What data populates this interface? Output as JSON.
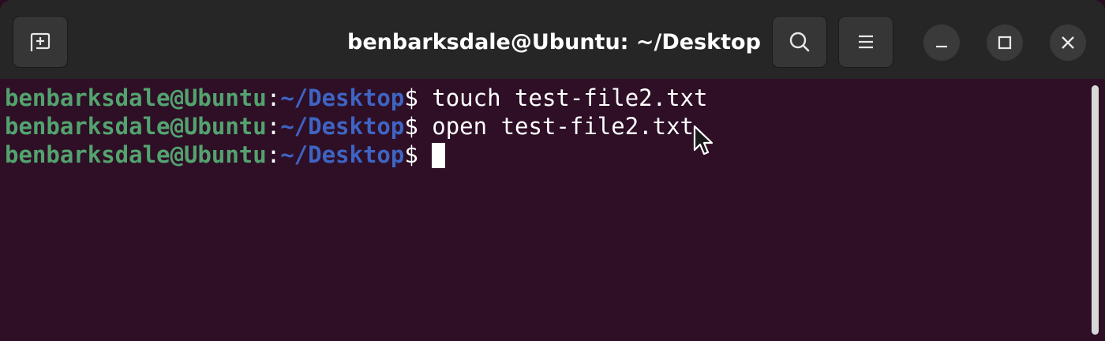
{
  "window": {
    "title": "benbarksdale@Ubuntu: ~/Desktop"
  },
  "titlebar": {
    "new_tab_icon": "new-tab-icon",
    "search_icon": "search-icon",
    "menu_icon": "hamburger-menu-icon",
    "minimize_icon": "minimize-icon",
    "maximize_icon": "maximize-icon",
    "close_icon": "close-icon"
  },
  "terminal": {
    "lines": [
      {
        "user": "benbarksdale@Ubuntu",
        "sep": ":",
        "path": "~/Desktop",
        "prompt": "$ ",
        "command": "touch test-file2.txt"
      },
      {
        "user": "benbarksdale@Ubuntu",
        "sep": ":",
        "path": "~/Desktop",
        "prompt": "$ ",
        "command": "open test-file2.txt"
      },
      {
        "user": "benbarksdale@Ubuntu",
        "sep": ":",
        "path": "~/Desktop",
        "prompt": "$ ",
        "command": ""
      }
    ]
  },
  "colors": {
    "background": "#2e0f26",
    "titlebar": "#262626",
    "user": "#53a36f",
    "path": "#3e64c4"
  }
}
